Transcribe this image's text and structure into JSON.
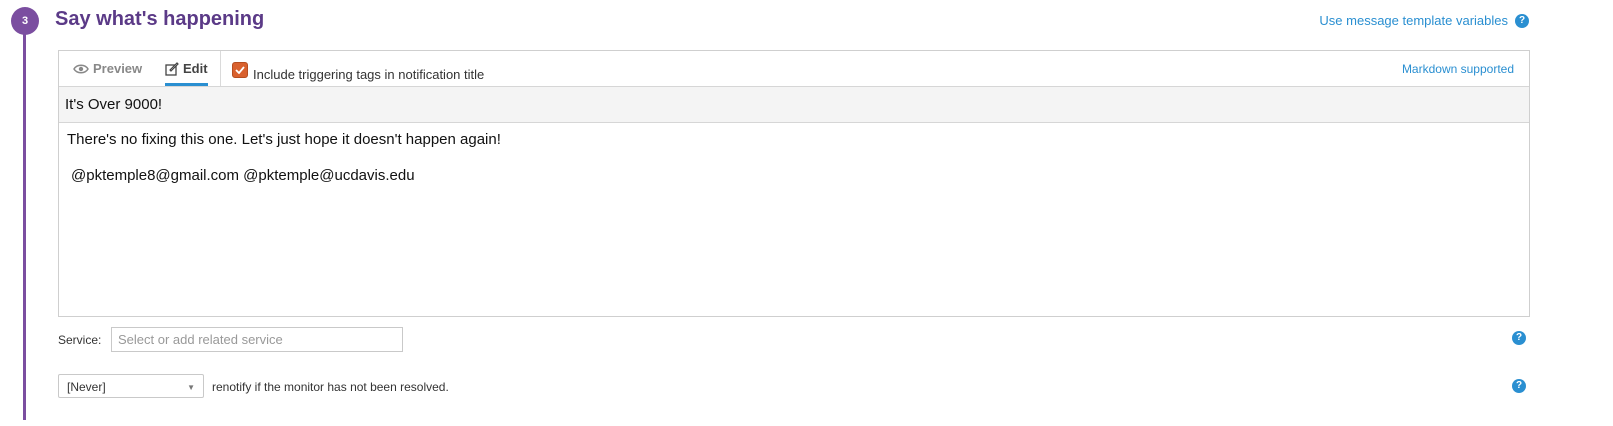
{
  "step": {
    "number": "3",
    "title": "Say what's happening",
    "color": "#7b4ea0"
  },
  "links": {
    "template_variables": "Use message template variables",
    "markdown": "Markdown supported"
  },
  "editor": {
    "tabs": [
      {
        "label": "Preview",
        "icon": "eye-icon",
        "active": false
      },
      {
        "label": "Edit",
        "icon": "pencil-icon",
        "active": true
      }
    ],
    "include_tags": {
      "label": "Include triggering tags in notification title",
      "checked": true
    },
    "title_value": "It's Over 9000!",
    "body_lines": [
      "There's no fixing this one. Let's just hope it doesn't happen again!",
      "@pktemple8@gmail.com @pktemple@ucdavis.edu"
    ]
  },
  "service": {
    "label": "Service:",
    "placeholder": "Select or add related service"
  },
  "renotify": {
    "selected": "[Never]",
    "text": "renotify if the monitor has not been resolved."
  },
  "colors": {
    "accent": "#2a8fd1",
    "step_purple": "#7b4ea0",
    "checkbox": "#d9612e"
  },
  "help_icon_glyph": "?"
}
